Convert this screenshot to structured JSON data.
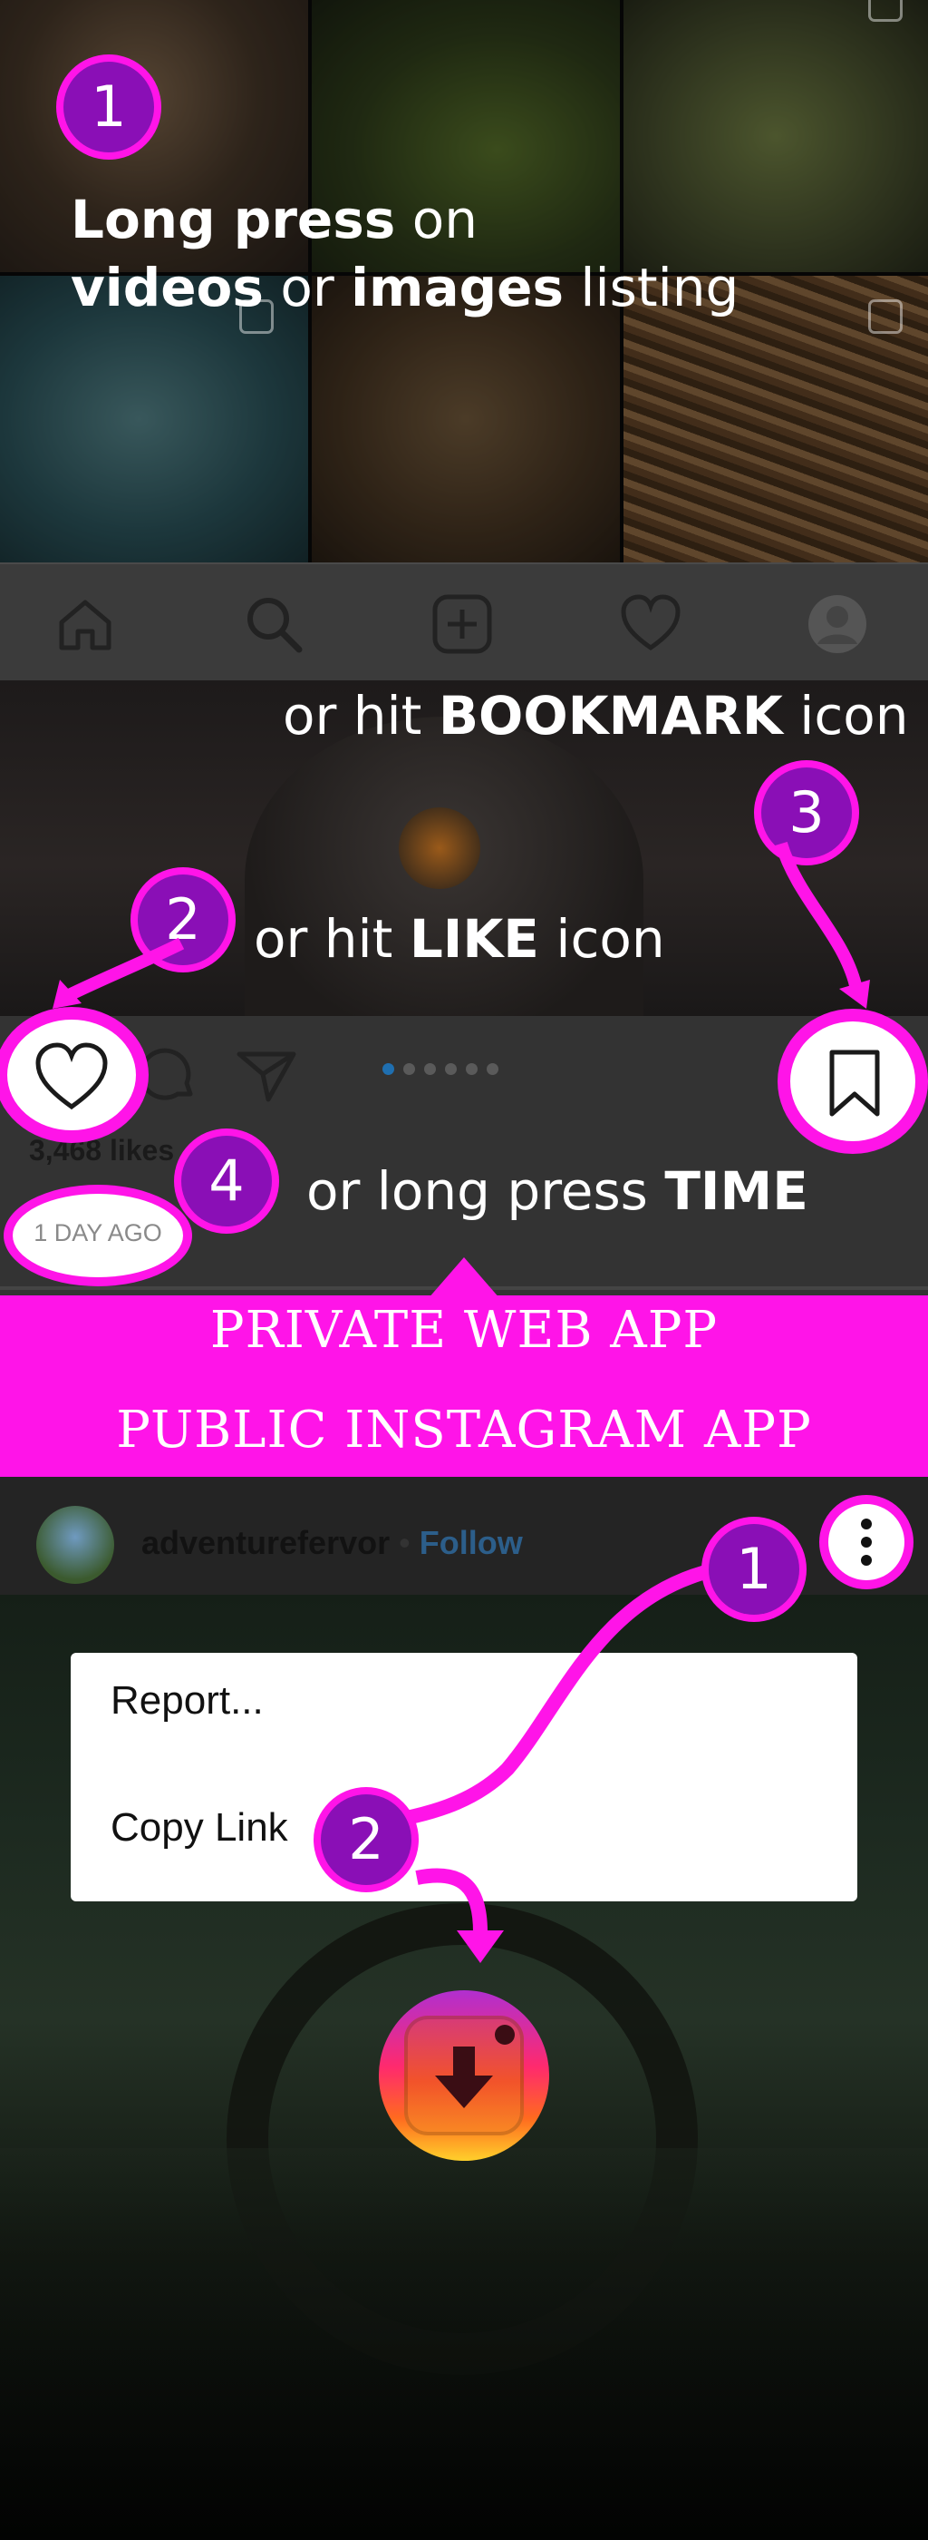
{
  "step1": {
    "number": "1",
    "caption_bold1": "Long press",
    "caption_text1": " on",
    "caption_bold2": "videos",
    "caption_text2": " or ",
    "caption_bold3": "images",
    "caption_text3": " listing"
  },
  "nav": {
    "items": [
      "home-icon",
      "search-icon",
      "add-post-icon",
      "activity-heart-icon",
      "profile-avatar-icon"
    ]
  },
  "step3": {
    "number": "3",
    "caption_text": "or hit ",
    "caption_bold": "BOOKMARK",
    "caption_after": " icon"
  },
  "step2": {
    "number": "2",
    "caption_text": "or hit ",
    "caption_bold": "LIKE",
    "caption_after": " icon"
  },
  "post": {
    "likes": "3,468 likes",
    "time": "1 DAY AGO",
    "carousel_count": 6,
    "carousel_active": 1
  },
  "step4": {
    "number": "4",
    "caption_text": "or long press ",
    "caption_bold": "TIME"
  },
  "banner": {
    "line1": "PRIVATE WEB APP",
    "line2": "PUBLIC INSTAGRAM APP"
  },
  "ig": {
    "username": "adventurefervor",
    "separator": "•",
    "follow": "Follow",
    "menu": [
      "Report...",
      "Copy Link"
    ],
    "step1_number": "1",
    "step2_number": "2"
  },
  "colors": {
    "accent": "#ff14e8",
    "badge": "#8a0fb6",
    "follow": "#3b82c4",
    "app_icon_top": "#c32cd1",
    "app_icon_bottom": "#ffd02b"
  }
}
